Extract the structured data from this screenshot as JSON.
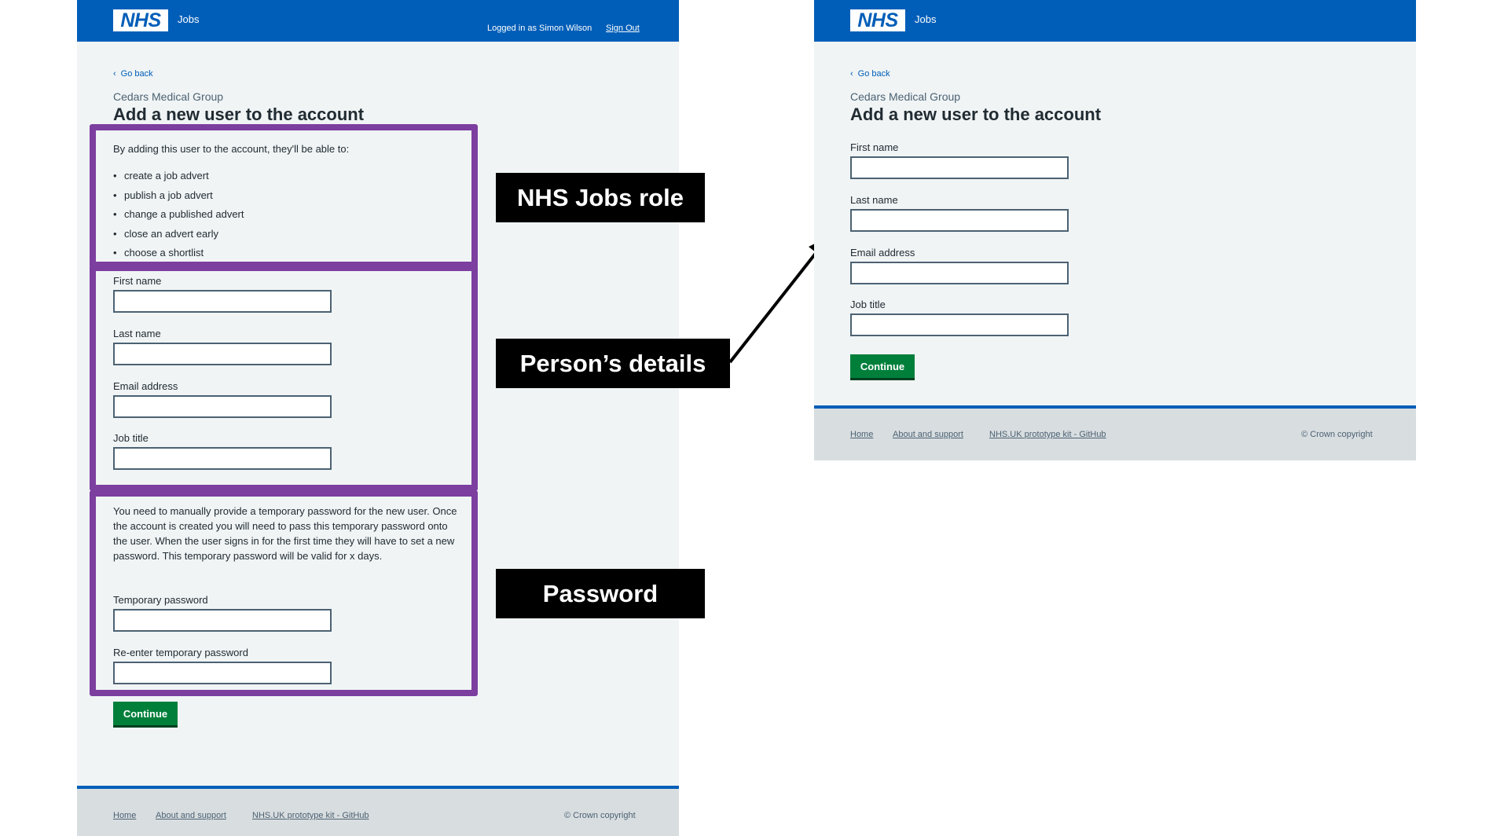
{
  "header": {
    "logo": "NHS",
    "service_name": "Jobs",
    "logged_in_text": "Logged in as Simon Wilson",
    "sign_out": "Sign Out"
  },
  "form": {
    "back_link": "Go back",
    "caption": "Cedars Medical Group",
    "title": "Add a new user to the account",
    "role_intro": "By adding this user to the account, they'll be able to:",
    "role_items": [
      "create a job advert",
      "publish a job advert",
      "change a published advert",
      "close an advert early",
      "choose a shortlist"
    ],
    "first_name_label": "First name",
    "last_name_label": "Last name",
    "email_label": "Email address",
    "job_title_label": "Job title",
    "password_text": "You need to manually provide a temporary password for the new user. Once the account is created you will need to pass this temporary password onto the user. When the user signs in for the first time they will have to set a new password. This temporary password will be valid for x days.",
    "temp_password_label": "Temporary password",
    "reenter_password_label": "Re-enter temporary password",
    "continue": "Continue"
  },
  "footer": {
    "links": [
      "Home",
      "About and support",
      "NHS.UK prototype kit - GitHub"
    ],
    "copyright": "© Crown copyright"
  },
  "annotations": {
    "role_callout": "NHS Jobs role",
    "details_callout": "Person’s details",
    "password_callout": "Password"
  },
  "colors": {
    "nhs_blue": "#005eb8",
    "page_background": "#f0f4f5",
    "button_green": "#007f3b",
    "highlight_purple": "#7c3e9f",
    "footer_grey": "#d8dde0"
  }
}
